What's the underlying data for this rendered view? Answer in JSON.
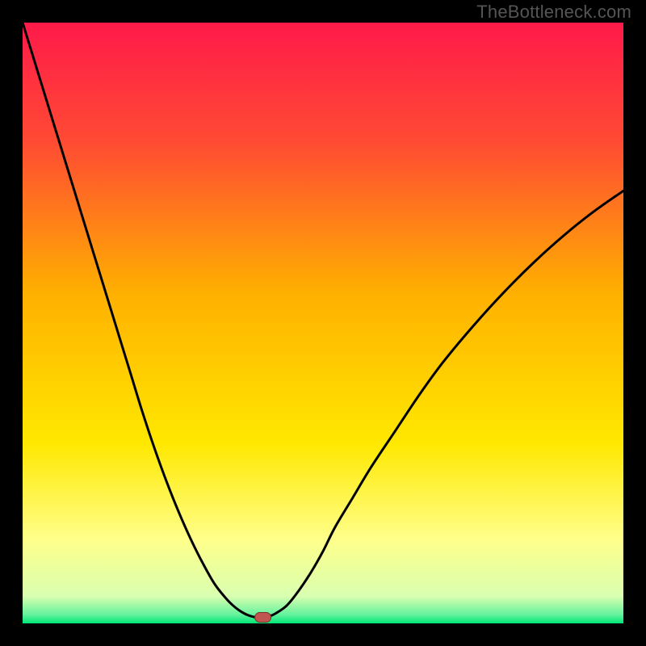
{
  "watermark": "TheBottleneck.com",
  "colors": {
    "top": "#ff1a4a",
    "upper_mid": "#ff6a2a",
    "mid": "#ffd400",
    "lower_mid": "#ffff66",
    "bottom": "#00e676",
    "curve": "#000000",
    "marker_fill": "#c1554f",
    "marker_stroke": "#7a2f2a",
    "frame": "#000000"
  },
  "chart_data": {
    "type": "line",
    "title": "",
    "xlabel": "",
    "ylabel": "",
    "xlim": [
      0,
      100
    ],
    "ylim": [
      0,
      100
    ],
    "x": [
      0,
      2,
      4,
      6,
      8,
      10,
      12,
      14,
      16,
      18,
      20,
      22,
      24,
      26,
      28,
      30,
      32,
      34,
      35,
      36,
      37,
      38,
      39,
      40,
      41,
      42,
      44,
      46,
      48,
      50,
      52,
      55,
      58,
      62,
      66,
      70,
      75,
      80,
      85,
      90,
      95,
      100
    ],
    "values": [
      100,
      93.5,
      87,
      80.5,
      74,
      67.5,
      61,
      54.5,
      48,
      41.5,
      35,
      29,
      23.5,
      18.5,
      14,
      10,
      6.5,
      4,
      3,
      2.2,
      1.6,
      1.2,
      1,
      1,
      1.2,
      1.6,
      3,
      5.5,
      8.5,
      12,
      16,
      21,
      26,
      32,
      38,
      43.5,
      49.5,
      55,
      60,
      64.5,
      68.5,
      72
    ],
    "marker": {
      "x": 40,
      "y": 1
    },
    "gradient_stops": [
      {
        "offset": 0.0,
        "color": "#ff1a4a"
      },
      {
        "offset": 0.2,
        "color": "#ff4b33"
      },
      {
        "offset": 0.45,
        "color": "#ffb000"
      },
      {
        "offset": 0.7,
        "color": "#ffe800"
      },
      {
        "offset": 0.86,
        "color": "#ffff8a"
      },
      {
        "offset": 0.955,
        "color": "#d9ffb0"
      },
      {
        "offset": 0.985,
        "color": "#66f29e"
      },
      {
        "offset": 1.0,
        "color": "#00e676"
      }
    ]
  }
}
